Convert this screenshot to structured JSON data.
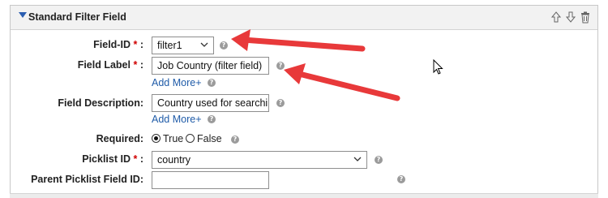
{
  "panel": {
    "title": "Standard Filter Field"
  },
  "fields": {
    "field_id": {
      "label": "Field-ID",
      "required_mark": "*",
      "colon": ":",
      "value": "filter1"
    },
    "field_label": {
      "label": "Field Label",
      "required_mark": "*",
      "colon": ":",
      "value": "Job Country (filter field)",
      "add_more": "Add More+"
    },
    "field_description": {
      "label": "Field Description:",
      "value": "Country used for searching",
      "add_more": "Add More+"
    },
    "required": {
      "label": "Required:",
      "option_true": "True",
      "option_false": "False",
      "selected": "True"
    },
    "picklist_id": {
      "label": "Picklist ID",
      "required_mark": "*",
      "colon": ":",
      "value": "country"
    },
    "parent_picklist": {
      "label": "Parent Picklist Field ID:",
      "value": ""
    }
  },
  "help_glyph": "?",
  "colors": {
    "arrow": "#e8393a",
    "link": "#1f5ba8",
    "required": "#d00000",
    "header_bg": "#f2f2f2"
  },
  "icons": [
    "collapse-triangle-icon",
    "move-up-icon",
    "move-down-icon",
    "delete-icon",
    "help-icon",
    "dropdown-caret-icon",
    "mouse-cursor-icon",
    "annotation-arrow"
  ]
}
